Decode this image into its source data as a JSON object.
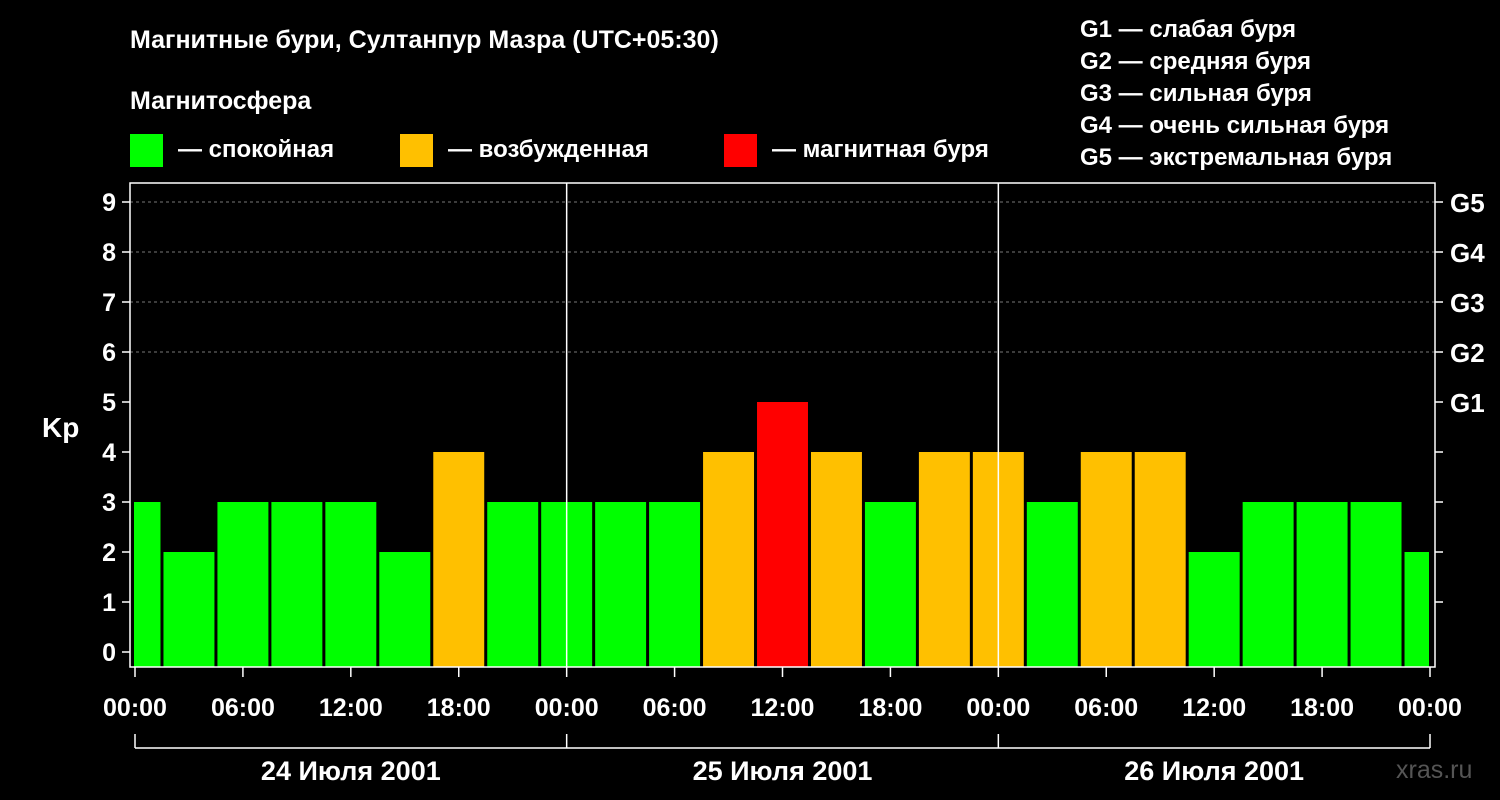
{
  "header": {
    "title": "Магнитные бури, Султанпур Мазра (UTC+05:30)",
    "magnetosphere_label": "Магнитосфера",
    "legend": [
      {
        "color": "#00ff00",
        "label": "— спокойная"
      },
      {
        "color": "#ffc000",
        "label": "— возбужденная"
      },
      {
        "color": "#ff0000",
        "label": "— магнитная буря"
      }
    ],
    "g_scale": [
      "G1 — слабая буря",
      "G2 — средняя буря",
      "G3 — сильная буря",
      "G4 — очень сильная буря",
      "G5 — экстремальная буря"
    ]
  },
  "watermark": "xras.ru",
  "chart_data": {
    "type": "bar",
    "ylabel": "Kp",
    "ylim": [
      0,
      9
    ],
    "y_ticks": [
      0,
      1,
      2,
      3,
      4,
      5,
      6,
      7,
      8,
      9
    ],
    "right_ticks": [
      {
        "value": 5,
        "label": "G1"
      },
      {
        "value": 6,
        "label": "G2"
      },
      {
        "value": 7,
        "label": "G3"
      },
      {
        "value": 8,
        "label": "G4"
      },
      {
        "value": 9,
        "label": "G5"
      }
    ],
    "x_tick_labels": [
      "00:00",
      "06:00",
      "12:00",
      "18:00",
      "00:00",
      "06:00",
      "12:00",
      "18:00",
      "00:00",
      "06:00",
      "12:00",
      "18:00",
      "00:00"
    ],
    "x_tick_hours": [
      0,
      6,
      12,
      18,
      24,
      30,
      36,
      42,
      48,
      54,
      60,
      66,
      72
    ],
    "days": [
      "24 Июля 2001",
      "25 Июля 2001",
      "26 Июля 2001"
    ],
    "interval_hours": 3,
    "first_bar_start_hour": -1.5,
    "values": [
      3,
      2,
      3,
      3,
      3,
      2,
      4,
      3,
      3,
      3,
      3,
      4,
      5,
      4,
      3,
      4,
      4,
      3,
      4,
      4,
      2,
      3,
      3,
      3,
      2
    ],
    "colors": {
      "calm": "#00ff00",
      "active": "#ffc000",
      "storm": "#ff0000"
    },
    "grid": true
  }
}
